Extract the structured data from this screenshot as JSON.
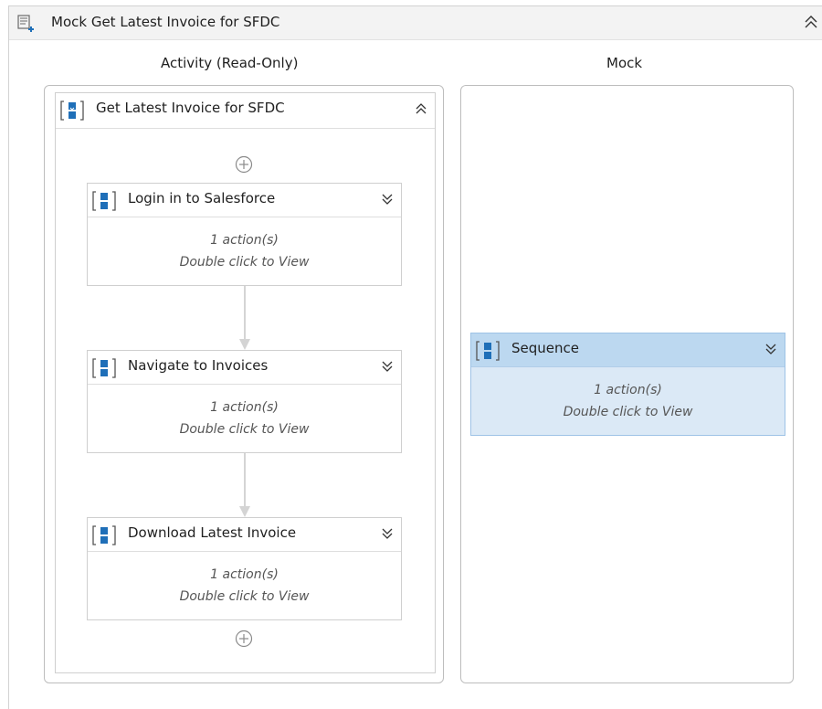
{
  "header": {
    "title": "Mock Get Latest Invoice for SFDC"
  },
  "columns": {
    "left_title": "Activity (Read-Only)",
    "right_title": "Mock"
  },
  "outer_sequence": {
    "label": "Get Latest Invoice for SFDC"
  },
  "activities": [
    {
      "label": "Login in to Salesforce",
      "count": "1 action(s)",
      "hint": "Double click to View"
    },
    {
      "label": "Navigate to Invoices",
      "count": "1 action(s)",
      "hint": "Double click to View"
    },
    {
      "label": "Download Latest Invoice",
      "count": "1 action(s)",
      "hint": "Double click to View"
    }
  ],
  "mock_sequence": {
    "label": "Sequence",
    "count": "1 action(s)",
    "hint": "Double click to View"
  },
  "icons": {
    "sequence": "sequence-icon",
    "mock": "mock-activity-icon",
    "collapse": "collapse-double-chevron-up-icon",
    "expand": "expand-double-chevron-down-icon",
    "add": "add-activity-plus-icon",
    "connector": "flow-arrow-icon"
  },
  "colors": {
    "accent": "#1f6fb8",
    "selected_header": "#bcd8f0"
  }
}
